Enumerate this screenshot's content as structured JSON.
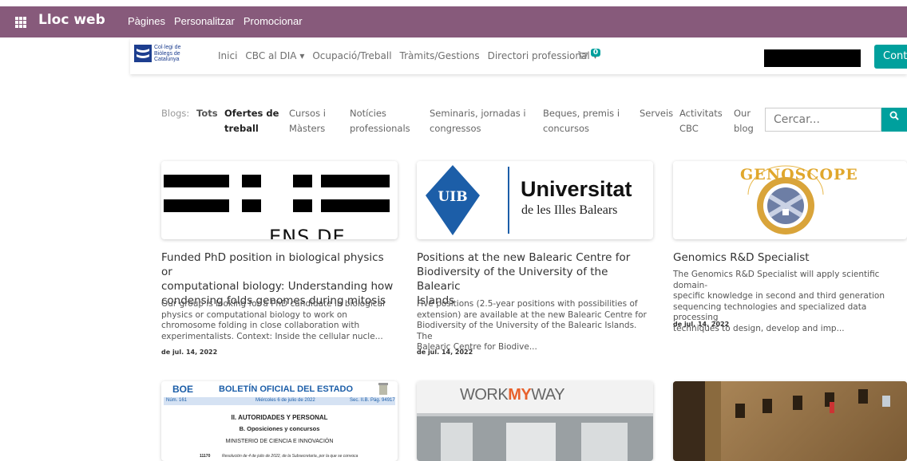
{
  "topbar": {
    "brand": "Lloc web",
    "menu": [
      "Pàgines",
      "Personalitzar",
      "Promocionar"
    ]
  },
  "sitenav": {
    "logo_lines": [
      "Col·legi de",
      "Biòlegs de",
      "Catalunya"
    ],
    "links": [
      "Inici",
      "CBC al DIA ▾",
      "Ocupació/Treball",
      "Tràmits/Gestions",
      "Directori professional ▾"
    ],
    "cart_count": "0",
    "contact_label": "Conta"
  },
  "filters": {
    "label": "Blogs:",
    "items": [
      {
        "line1": "Tots",
        "line2": ""
      },
      {
        "line1": "Ofertes de",
        "line2": "treball"
      },
      {
        "line1": "Cursos i",
        "line2": "Màsters"
      },
      {
        "line1": "Notícies",
        "line2": "professionals"
      },
      {
        "line1": "Seminaris, jornadas i",
        "line2": "congressos"
      },
      {
        "line1": "Beques, premis i",
        "line2": "concursos"
      },
      {
        "line1": "Serveis",
        "line2": ""
      },
      {
        "line1": "Activitats",
        "line2": "CBC"
      },
      {
        "line1": "Our",
        "line2": "blog"
      }
    ],
    "search_placeholder": "Cercar..."
  },
  "posts": [
    {
      "image_text": "ENS DE LYON",
      "title_lines": [
        "Funded PhD position in biological physics or",
        "computational biology: Understanding how",
        "condensing folds genomes during mitosis"
      ],
      "desc_lines": [
        "Our group is looking for a PhD candidate in biological",
        "physics or computational biology to work on",
        "chromosome folding in close collaboration with",
        "experimentalists. Context: Inside the cellular nucle..."
      ],
      "date": "de jul. 14, 2022"
    },
    {
      "image_text": "UIB",
      "image_title": "Universitat",
      "image_subtitle": "de les Illes Balears",
      "title_lines": [
        "Positions at the new Balearic Centre for",
        "Biodiversity of the University of the Balearic",
        "Islands"
      ],
      "desc_lines": [
        "Five positions (2.5-year positions with possibilities of",
        "extension) are available at the new Balearic Centre for",
        "Biodiversity of the University of the Balearic Islands. The",
        "Balearic Centre for Biodive..."
      ],
      "date": "de jul. 14, 2022"
    },
    {
      "image_text": "GENOSCOPE",
      "title_lines": [
        "Genomics R&D Specialist"
      ],
      "desc_lines": [
        "The Genomics R&D Specialist will apply scientific domain-",
        "specific knowledge in second and third generation",
        "sequencing technologies and specialized data processing",
        "techniques to design, develop and imp..."
      ],
      "date": "de jul. 14, 2022"
    }
  ],
  "posts_row2": [
    {
      "boe_logo": "BOE",
      "boe_title": "BOLETÍN OFICIAL DEL ESTADO",
      "boe_num": "Núm. 161",
      "boe_date": "Miércoles 6 de julio de 2022",
      "boe_page": "Sec. II.B.  Pág. 94917",
      "boe_section": "II. AUTORIDADES Y PERSONAL",
      "boe_subsection": "B. Oposiciones y concursos",
      "boe_ministry": "MINISTERIO DE CIENCIA E INNOVACIÓN",
      "boe_item": "11170",
      "boe_item_text": "Resolución de 4 de julio de 2022, de la Subsecretaría, por la que se convoca"
    },
    {
      "image_text_1": "WORK",
      "image_text_2": "MY",
      "image_text_3": "WAY"
    },
    {}
  ],
  "colors": {
    "topbar": "#875a7b",
    "accent": "#00a09d",
    "logo": "#1d3e8f",
    "uib": "#1c5ea8"
  }
}
